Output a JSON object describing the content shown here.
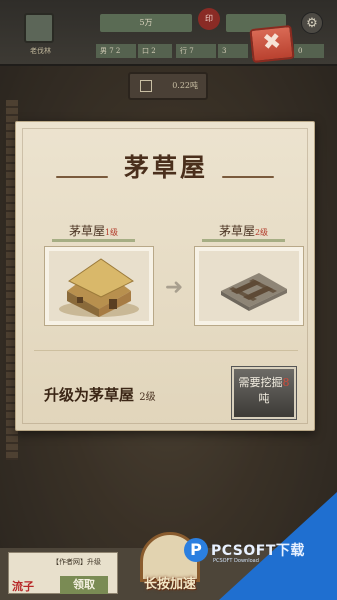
{
  "topbar": {
    "avatar_label": "老伐林",
    "stat_top": "5万",
    "seal_text": "印",
    "cells": [
      "男 7 2",
      "口 2",
      "行 7",
      "3",
      "牛 7",
      "0"
    ]
  },
  "resource": {
    "value": "0.22吨"
  },
  "dialog": {
    "title": "茅草屋",
    "close_label": "✖",
    "current": {
      "name": "茅草屋",
      "level": "1级"
    },
    "next": {
      "name": "茅草屋",
      "level": "2级"
    },
    "arrow": "➜",
    "upgrade_text": "升级为茅草屋",
    "upgrade_level": "2级",
    "dig_button": {
      "line1": "需要挖掘",
      "num": "8",
      "line2": "吨"
    }
  },
  "bottom": {
    "claim_text": "【作者网】升级",
    "claim_title": "流子",
    "claim_button": "领取",
    "speed_button": "长按加速",
    "day_label": "0-13"
  },
  "watermark": {
    "logo_letter": "P",
    "text": "PCSOFT下载",
    "sub": "PCSOFT Download"
  },
  "colors": {
    "dialog_bg": "#ece3cf",
    "title": "#4a2f1c",
    "close": "#c94f3c",
    "level_red": "#b23a2a",
    "watermark_blue": "#1f6fd0"
  }
}
